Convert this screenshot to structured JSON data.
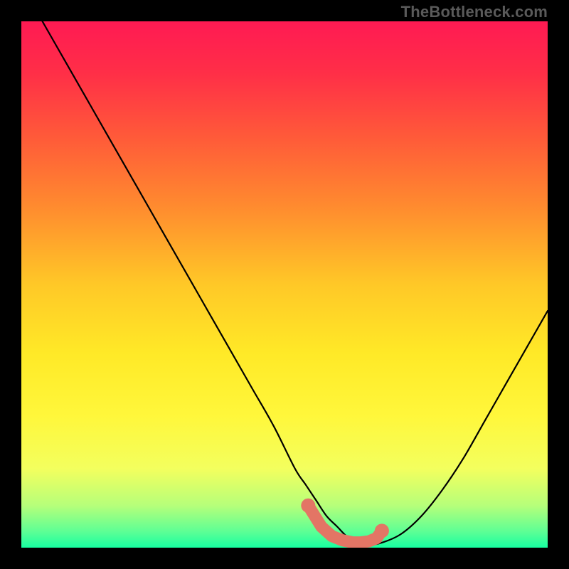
{
  "watermark": "TheBottleneck.com",
  "gradient": {
    "stops": [
      {
        "offset": 0.0,
        "color": "#ff1a53"
      },
      {
        "offset": 0.1,
        "color": "#ff2f47"
      },
      {
        "offset": 0.22,
        "color": "#ff5a39"
      },
      {
        "offset": 0.35,
        "color": "#ff8a2f"
      },
      {
        "offset": 0.5,
        "color": "#ffc827"
      },
      {
        "offset": 0.63,
        "color": "#ffe927"
      },
      {
        "offset": 0.75,
        "color": "#fff73b"
      },
      {
        "offset": 0.85,
        "color": "#f3ff5e"
      },
      {
        "offset": 0.92,
        "color": "#b6ff7a"
      },
      {
        "offset": 0.97,
        "color": "#5cff95"
      },
      {
        "offset": 1.0,
        "color": "#17ffa1"
      }
    ]
  },
  "chart_data": {
    "type": "line",
    "title": "",
    "xlabel": "",
    "ylabel": "",
    "xlim": [
      0,
      100
    ],
    "ylim": [
      0,
      100
    ],
    "series": [
      {
        "name": "curve",
        "x": [
          4,
          8,
          12,
          16,
          20,
          24,
          28,
          32,
          36,
          40,
          44,
          48,
          52,
          54,
          56,
          58,
          60,
          62,
          64,
          66,
          68,
          72,
          76,
          80,
          84,
          88,
          92,
          96,
          100
        ],
        "y": [
          100,
          93,
          86,
          79,
          72,
          65,
          58,
          51,
          44,
          37,
          30,
          23,
          15,
          12,
          9,
          6,
          4,
          2,
          1.0,
          0.7,
          0.8,
          2.5,
          6,
          11,
          17,
          24,
          31,
          38,
          45
        ]
      }
    ],
    "markers": {
      "name": "highlight",
      "color": "#e37565",
      "x": [
        54.5,
        57,
        59,
        61,
        63,
        64.5,
        66,
        67.5,
        68.5
      ],
      "y": [
        8.0,
        4.0,
        2.2,
        1.4,
        1.0,
        1.0,
        1.2,
        1.8,
        3.2
      ]
    }
  }
}
